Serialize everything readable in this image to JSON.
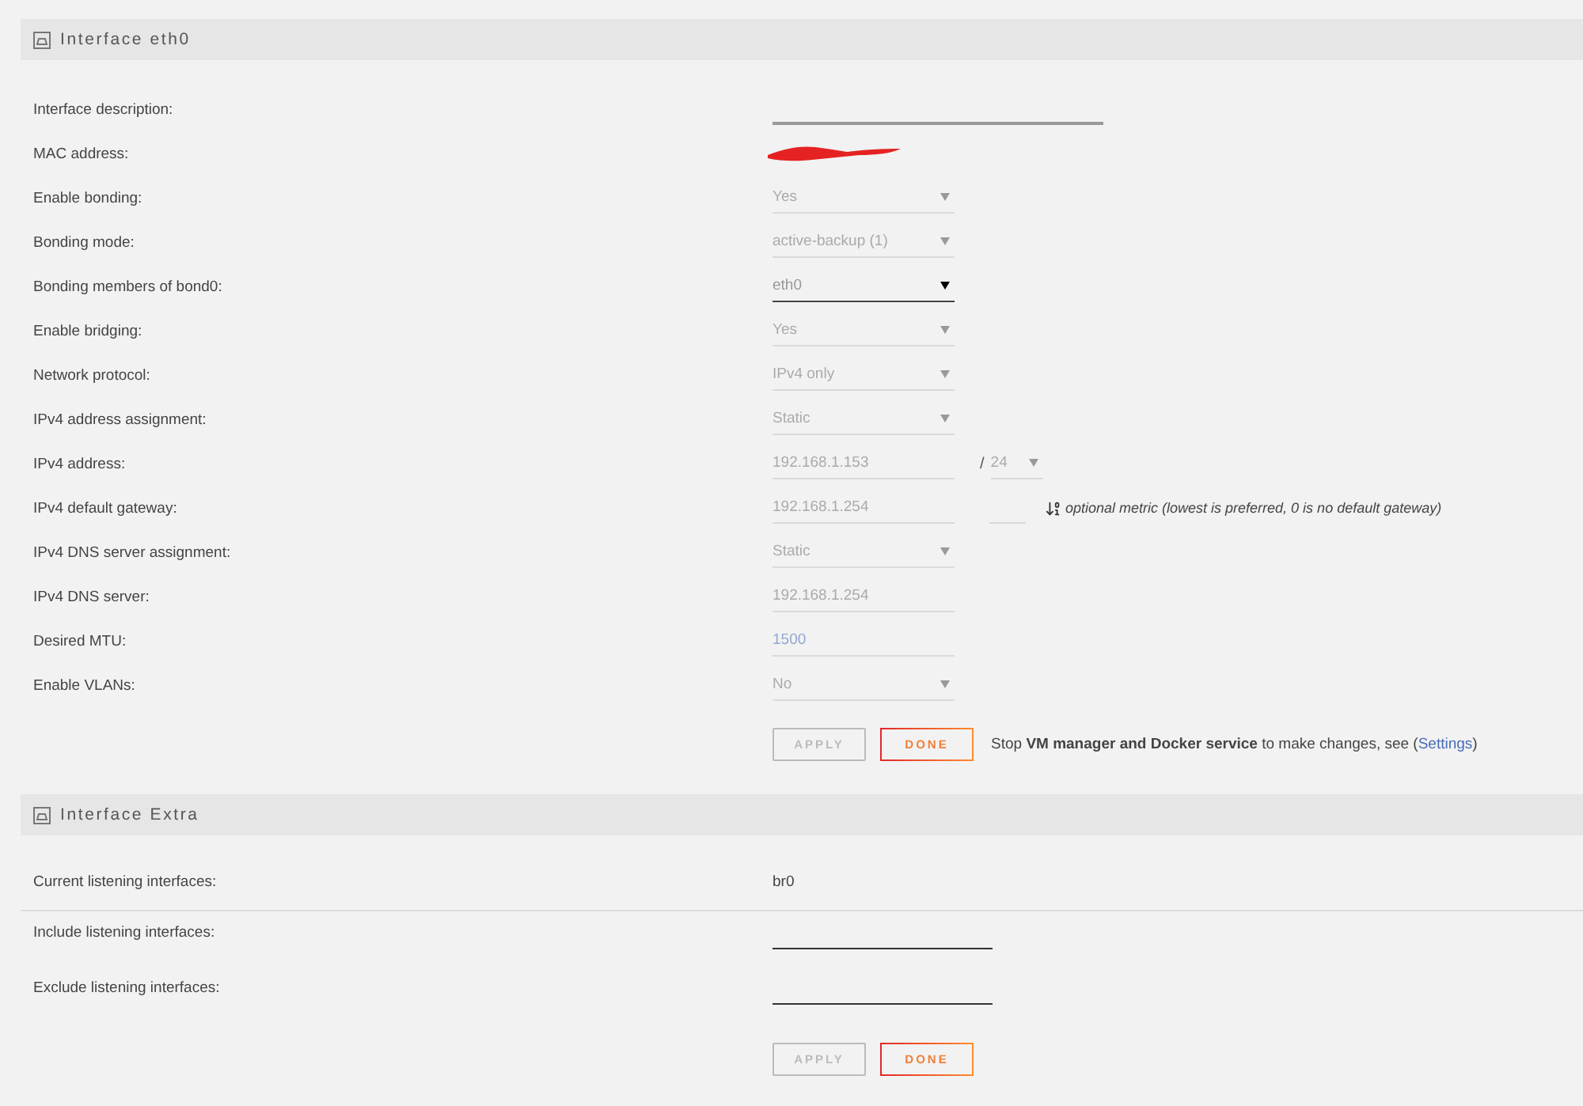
{
  "sections": [
    {
      "title": "Interface eth0",
      "rows": [
        {
          "kind": "input",
          "label": "Interface description:",
          "disabled": false
        },
        {
          "kind": "redacted",
          "label": "MAC address:"
        },
        {
          "kind": "select",
          "label": "Enable bonding:",
          "value": "Yes",
          "disabled": true
        },
        {
          "kind": "select",
          "label": "Bonding mode:",
          "value": "active-backup (1)",
          "disabled": true
        },
        {
          "kind": "select",
          "label": "Bonding members of bond0:",
          "value": "eth0",
          "disabled": false
        },
        {
          "kind": "select",
          "label": "Enable bridging:",
          "value": "Yes",
          "disabled": true
        },
        {
          "kind": "select",
          "label": "Network protocol:",
          "value": "IPv4 only",
          "disabled": true
        },
        {
          "kind": "select",
          "label": "IPv4 address assignment:",
          "value": "Static",
          "disabled": true
        },
        {
          "kind": "address",
          "label": "IPv4 address:",
          "value": "192.168.1.153",
          "separator": "/",
          "mask": "24",
          "disabled": true
        },
        {
          "kind": "gateway",
          "label": "IPv4 default gateway:",
          "value": "192.168.1.254",
          "note": "optional metric (lowest is preferred, 0 is no default gateway)",
          "disabled": true
        },
        {
          "kind": "select",
          "label": "IPv4 DNS server assignment:",
          "value": "Static",
          "disabled": true
        },
        {
          "kind": "input",
          "label": "IPv4 DNS server:",
          "value": "192.168.1.254",
          "disabled": true
        },
        {
          "kind": "number",
          "label": "Desired MTU:",
          "value": "1500",
          "disabled": true
        },
        {
          "kind": "select",
          "label": "Enable VLANs:",
          "value": "No",
          "disabled": true
        }
      ],
      "buttons": [
        {
          "label": "APPLY",
          "disabled": true
        },
        {
          "label": "DONE",
          "disabled": false
        }
      ],
      "notice": {
        "text": "Stop **VM manager and Docker service** to make changes, see (",
        "link": "Settings",
        "end": ")"
      }
    },
    {
      "title": "Interface Extra",
      "rows": [
        {
          "kind": "static",
          "label": "Current listening interfaces:",
          "value": "br0",
          "divider": true
        },
        {
          "kind": "input",
          "label": "Include listening interfaces:",
          "disabled": false,
          "divider": false
        },
        {
          "kind": "input",
          "label": "Exclude listening interfaces:",
          "disabled": false,
          "divider": false
        }
      ],
      "buttons": [
        {
          "label": "APPLY",
          "disabled": true
        },
        {
          "label": "DONE",
          "disabled": false
        }
      ]
    }
  ]
}
